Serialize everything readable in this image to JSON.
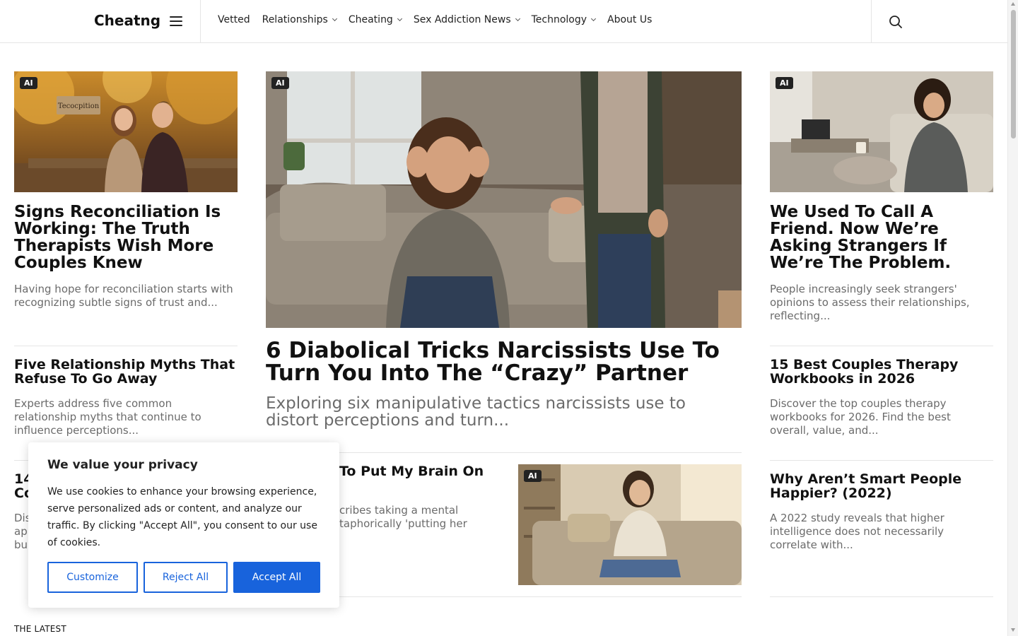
{
  "header": {
    "brand": "Cheatng",
    "nav": [
      {
        "label": "Vetted",
        "has_dropdown": false
      },
      {
        "label": "Relationships",
        "has_dropdown": true
      },
      {
        "label": "Cheating",
        "has_dropdown": true
      },
      {
        "label": "Sex Addiction News",
        "has_dropdown": true
      },
      {
        "label": "Technology",
        "has_dropdown": true
      },
      {
        "label": "About Us",
        "has_dropdown": false
      }
    ],
    "icons": {
      "menu": "hamburger-icon",
      "search": "search-icon"
    }
  },
  "badge_label": "AI",
  "left_column": [
    {
      "title": "Signs Reconciliation Is Working: The Truth Therapists Wish More Couples Knew",
      "excerpt": "Having hope for reconciliation starts with recognizing subtle signs of trust and...",
      "image_sign_text": "Tecocpition"
    },
    {
      "title": "Five Relationship Myths That Refuse To Go Away",
      "excerpt": "Experts address five common relationship myths that continue to influence perceptions..."
    },
    {
      "title_visible": [
        "14",
        "Co"
      ],
      "excerpt_visible": [
        "Dis",
        "ap",
        "bu"
      ]
    }
  ],
  "center_column": {
    "featured": {
      "title": "6 Diabolical Tricks Narcissists Use To Turn You Into The “Crazy” Partner",
      "excerpt": "Exploring six manipulative tactics narcissists use to distort perceptions and turn..."
    },
    "secondary": {
      "title_visible": [
        "To Put My Brain On"
      ],
      "excerpt_visible": [
        "cribes taking a mental",
        "taphorically 'putting her"
      ]
    }
  },
  "right_column": [
    {
      "title": "We Used To Call A Friend. Now We’re Asking Strangers If We’re The Problem.",
      "excerpt": "People increasingly seek strangers' opinions to assess their relationships, reflecting..."
    },
    {
      "title": "15 Best Couples Therapy Workbooks in 2026",
      "excerpt": "Discover the top couples therapy workbooks for 2026. Find the best overall, value, and..."
    },
    {
      "title": "Why Aren’t Smart People Happier? (2022)",
      "excerpt": "A 2022 study reveals that higher intelligence does not necessarily correlate with..."
    }
  ],
  "section_label": "THE LATEST",
  "cookie": {
    "title": "We value your privacy",
    "text": "We use cookies to enhance your browsing experience, serve personalized ads or content, and analyze our traffic. By clicking \"Accept All\", you consent to our use of cookies.",
    "customize": "Customize",
    "reject": "Reject All",
    "accept": "Accept All"
  }
}
